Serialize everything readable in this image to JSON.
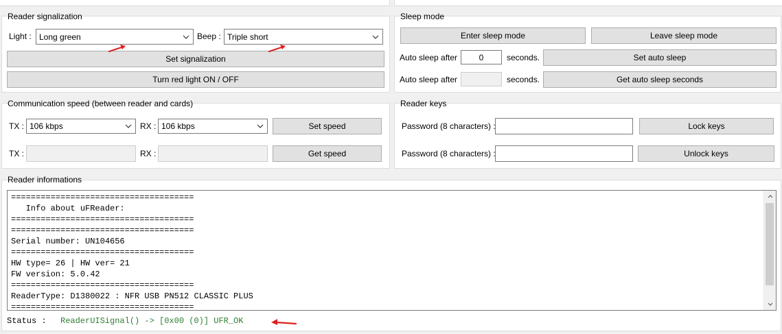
{
  "signalization": {
    "title": "Reader signalization",
    "light_label": "Light :",
    "light_value": "Long green",
    "beep_label": "Beep :",
    "beep_value": "Triple short",
    "set_button": "Set signalization",
    "red_light_button": "Turn red light ON / OFF"
  },
  "sleep": {
    "title": "Sleep mode",
    "enter_button": "Enter sleep mode",
    "leave_button": "Leave sleep mode",
    "auto_sleep_label": "Auto sleep after",
    "auto_sleep_value": "0",
    "seconds_label": "seconds.",
    "set_auto_button": "Set auto sleep",
    "get_auto_button": "Get auto sleep seconds"
  },
  "speed": {
    "title": "Communication speed (between reader and cards)",
    "tx_label": "TX :",
    "rx_label": "RX :",
    "tx_value": "106 kbps",
    "rx_value": "106 kbps",
    "set_button": "Set speed",
    "get_button": "Get speed"
  },
  "keys": {
    "title": "Reader keys",
    "password_label": "Password (8 characters) :",
    "lock_button": "Lock keys",
    "unlock_button": "Unlock keys"
  },
  "info": {
    "title": "Reader informations",
    "lines": [
      "=====================================",
      "   Info about uFReader:",
      "=====================================",
      "=====================================",
      "Serial number: UN104656",
      "=====================================",
      "HW type= 26 | HW ver= 21",
      "FW version: 5.0.42",
      "=====================================",
      "ReaderType: D1380022 : NFR USB PN512 CLASSIC PLUS",
      "====================================="
    ]
  },
  "status": {
    "label": "Status :",
    "value": "ReaderUISignal() -> [0x00 (0)] UFR_OK",
    "value_color": "#2e7d32"
  },
  "colors": {
    "annotation_arrow": "#e02020"
  }
}
